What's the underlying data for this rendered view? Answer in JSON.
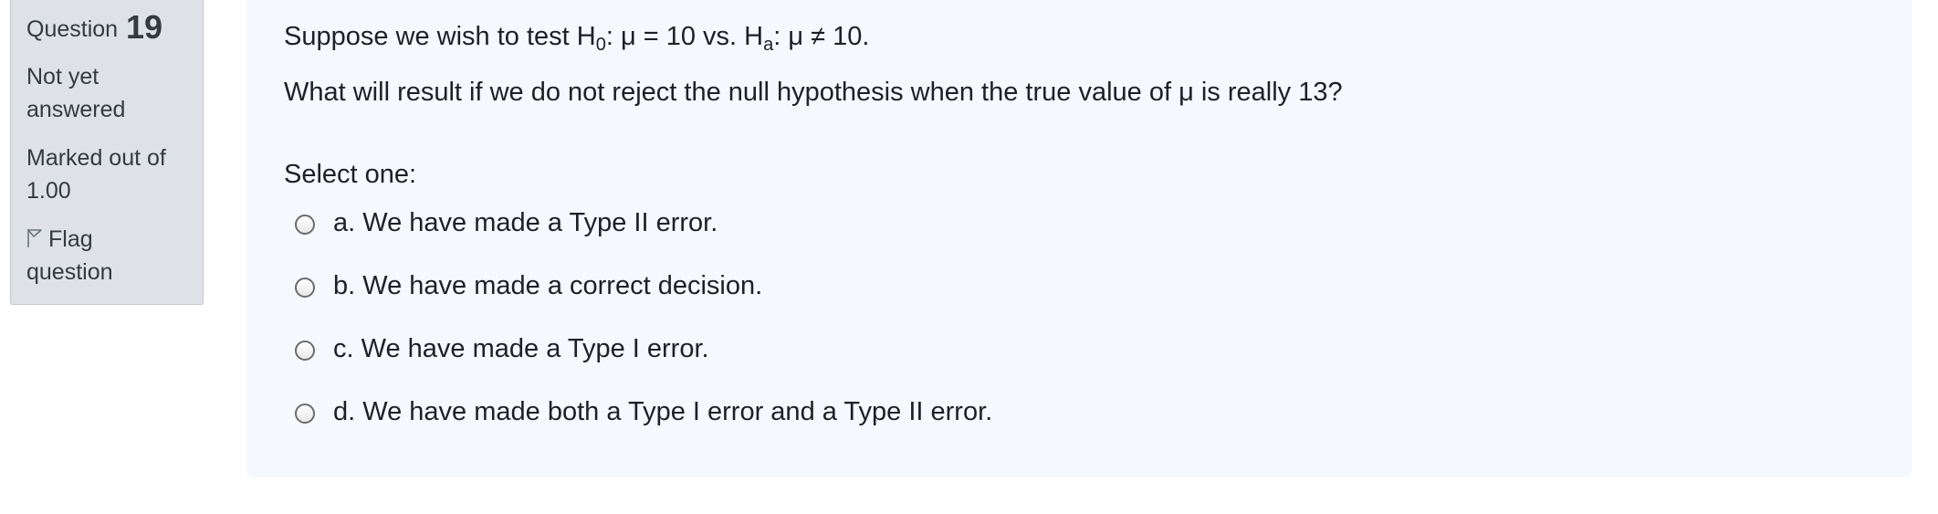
{
  "question_info": {
    "label": "Question",
    "number": "19",
    "state_line1": "Not yet",
    "state_line2": "answered",
    "grade_line1": "Marked out of",
    "grade_line2": "1.00",
    "flag_line1": "Flag",
    "flag_line2": "question"
  },
  "question": {
    "l1_pre": "Suppose we wish to test H",
    "l1_sub1": "0",
    "l1_mid": ": μ = 10 vs. H",
    "l1_sub2": "a",
    "l1_post": ": μ ≠ 10.",
    "line2": "What will result if we do not reject the null hypothesis when the true value of μ is really 13?",
    "prompt": "Select one:"
  },
  "answers": [
    {
      "label": "a. We have made a Type II error."
    },
    {
      "label": "b. We have made a correct decision."
    },
    {
      "label": "c. We have made a Type I error."
    },
    {
      "label": "d. We have made both a Type I error and a Type II error."
    }
  ]
}
